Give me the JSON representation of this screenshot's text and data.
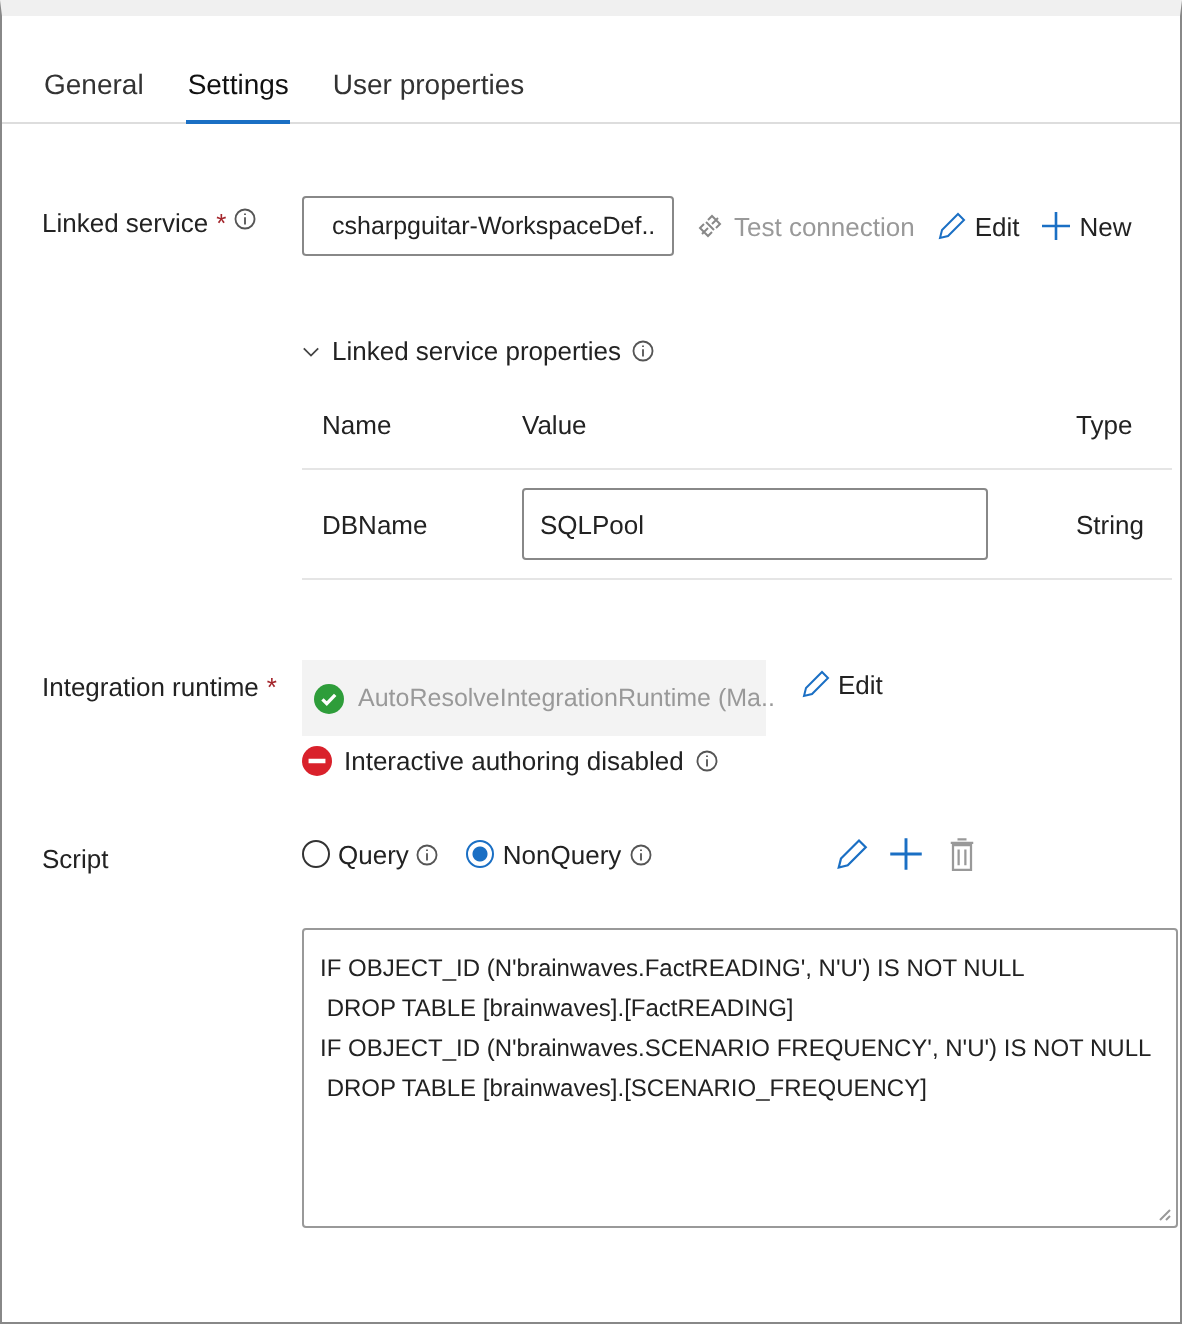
{
  "tabs": [
    {
      "label": "General",
      "selected": false
    },
    {
      "label": "Settings",
      "selected": true
    },
    {
      "label": "User properties",
      "selected": false
    }
  ],
  "linked_service": {
    "label": "Linked service",
    "required_mark": "*",
    "value": "csharpguitar-WorkspaceDef..",
    "test_connection": {
      "label": "Test connection",
      "disabled": true
    },
    "edit": "Edit",
    "new": "New"
  },
  "linked_service_properties": {
    "label": "Linked service properties",
    "expanded": true,
    "columns": [
      "Name",
      "Value",
      "Type"
    ],
    "rows": [
      {
        "name": "DBName",
        "value": "SQLPool",
        "type": "String"
      }
    ]
  },
  "integration_runtime": {
    "label": "Integration runtime",
    "required_mark": "*",
    "value": "AutoResolveIntegrationRuntime (Ma..",
    "disabled": true,
    "edit": "Edit",
    "status": {
      "kind": "error",
      "text": "Interactive authoring disabled"
    }
  },
  "script": {
    "label": "Script",
    "options": [
      {
        "label": "Query",
        "selected": false
      },
      {
        "label": "NonQuery",
        "selected": true
      }
    ],
    "lines": [
      "IF OBJECT_ID (N'brainwaves.FactREADING', N'U') IS NOT NULL",
      " DROP TABLE [brainwaves].[FactREADING]",
      "IF OBJECT_ID (N'brainwaves.SCENARIO FREQUENCY', N'U') IS NOT NULL",
      " DROP TABLE [brainwaves].[SCENARIO_FREQUENCY]"
    ]
  }
}
